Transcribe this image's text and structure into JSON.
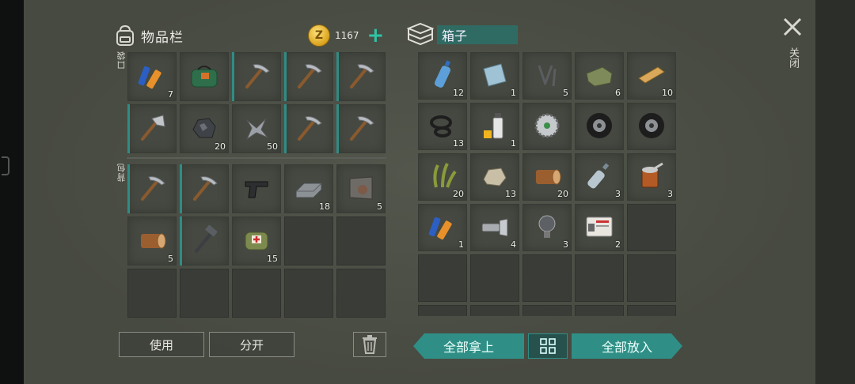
{
  "inventory": {
    "title": "物品栏",
    "coin_symbol": "Z",
    "coins": "1167",
    "add_label": "+",
    "pockets_label": "口袋",
    "backpack_label": "背包",
    "pockets": [
      {
        "icon": "batteries-icon",
        "qty": "7",
        "teal": false
      },
      {
        "icon": "duffel-bag-icon",
        "qty": "",
        "teal": false
      },
      {
        "icon": "pickaxe-icon",
        "qty": "",
        "teal": true
      },
      {
        "icon": "pickaxe-icon",
        "qty": "",
        "teal": true
      },
      {
        "icon": "pickaxe-icon",
        "qty": "",
        "teal": true
      },
      {
        "icon": "hatchet-icon",
        "qty": "",
        "teal": true
      },
      {
        "icon": "iron-ore-icon",
        "qty": "20",
        "teal": false
      },
      {
        "icon": "scrap-metal-icon",
        "qty": "50",
        "teal": false
      },
      {
        "icon": "pickaxe-icon",
        "qty": "",
        "teal": true
      },
      {
        "icon": "pickaxe-icon",
        "qty": "",
        "teal": true
      }
    ],
    "backpack": [
      {
        "icon": "pickaxe-icon",
        "qty": "",
        "teal": true
      },
      {
        "icon": "pickaxe-icon",
        "qty": "",
        "teal": true
      },
      {
        "icon": "pistol-icon",
        "qty": "",
        "teal": false
      },
      {
        "icon": "iron-bar-icon",
        "qty": "18",
        "teal": false
      },
      {
        "icon": "metal-plate-icon",
        "qty": "5",
        "teal": false
      },
      {
        "icon": "log-icon",
        "qty": "5",
        "teal": false
      },
      {
        "icon": "hammer-icon",
        "qty": "",
        "teal": true
      },
      {
        "icon": "medkit-bag-icon",
        "qty": "15",
        "teal": false
      },
      {
        "icon": "",
        "qty": "",
        "teal": false
      },
      {
        "icon": "",
        "qty": "",
        "teal": false
      },
      {
        "icon": "",
        "qty": "",
        "teal": false
      },
      {
        "icon": "",
        "qty": "",
        "teal": false
      },
      {
        "icon": "",
        "qty": "",
        "teal": false
      },
      {
        "icon": "",
        "qty": "",
        "teal": false
      },
      {
        "icon": "",
        "qty": "",
        "teal": false
      }
    ],
    "use_label": "使用",
    "split_label": "分开"
  },
  "box": {
    "title": "箱子",
    "slots": [
      {
        "icon": "water-bottle-icon",
        "qty": "12"
      },
      {
        "icon": "glass-pane-icon",
        "qty": "1"
      },
      {
        "icon": "nails-icon",
        "qty": "5"
      },
      {
        "icon": "cloth-icon",
        "qty": "6"
      },
      {
        "icon": "plank-icon",
        "qty": "10"
      },
      {
        "icon": "rubber-rings-icon",
        "qty": "13"
      },
      {
        "icon": "spray-paint-icon",
        "qty": "1"
      },
      {
        "icon": "saw-blade-icon",
        "qty": ""
      },
      {
        "icon": "tire-icon",
        "qty": ""
      },
      {
        "icon": "tire-icon",
        "qty": ""
      },
      {
        "icon": "plant-fiber-icon",
        "qty": "20"
      },
      {
        "icon": "stone-icon",
        "qty": "13"
      },
      {
        "icon": "log-icon",
        "qty": "20"
      },
      {
        "icon": "plastic-bottle-icon",
        "qty": "3"
      },
      {
        "icon": "tin-can-icon",
        "qty": "3"
      },
      {
        "icon": "batteries-icon",
        "qty": "1"
      },
      {
        "icon": "flashlight-icon",
        "qty": "4"
      },
      {
        "icon": "light-bulb-icon",
        "qty": "3"
      },
      {
        "icon": "id-card-icon",
        "qty": "2"
      },
      {
        "icon": "",
        "qty": ""
      },
      {
        "icon": "",
        "qty": ""
      },
      {
        "icon": "",
        "qty": ""
      },
      {
        "icon": "",
        "qty": ""
      },
      {
        "icon": "",
        "qty": ""
      },
      {
        "icon": "",
        "qty": ""
      },
      {
        "icon": "",
        "qty": ""
      },
      {
        "icon": "",
        "qty": ""
      },
      {
        "icon": "",
        "qty": ""
      },
      {
        "icon": "",
        "qty": ""
      },
      {
        "icon": "",
        "qty": ""
      }
    ],
    "take_all_label": "全部拿上",
    "put_all_label": "全部放入"
  },
  "close_label": "关闭",
  "colors": {
    "accent": "#2f8f86",
    "coin": "#d9a21c",
    "background": "#474a41"
  }
}
